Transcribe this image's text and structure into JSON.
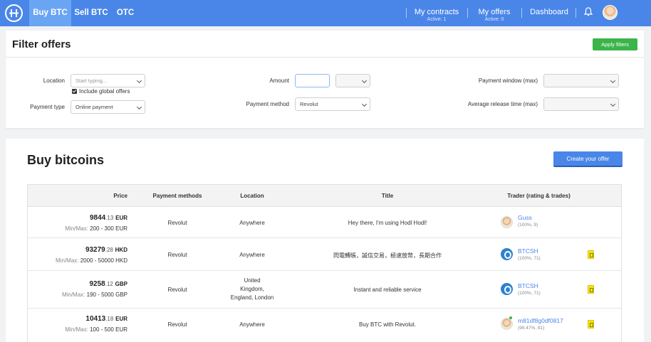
{
  "nav": {
    "tabs": [
      {
        "label": "Buy BTC",
        "active": true
      },
      {
        "label": "Sell BTC",
        "active": false
      },
      {
        "label": "OTC",
        "active": false
      }
    ],
    "links": [
      {
        "label": "My contracts",
        "sub": "Active: 1"
      },
      {
        "label": "My offers",
        "sub": "Active: 0"
      },
      {
        "label": "Dashboard",
        "sub": ""
      }
    ],
    "accent": "#4a86e8"
  },
  "filter": {
    "title": "Filter offers",
    "apply_label": "Apply filters",
    "location_label": "Location",
    "location_placeholder": "Start typing...",
    "include_global_label": "Include global offers",
    "include_global_checked": true,
    "payment_type_label": "Payment type",
    "payment_type_value": "Online payment",
    "amount_label": "Amount",
    "amount_value": "",
    "payment_method_label": "Payment method",
    "payment_method_value": "Revolut",
    "payment_window_label": "Payment window (max)",
    "release_time_label": "Average release time (max)"
  },
  "buy": {
    "title": "Buy bitcoins",
    "create_label": "Create your offer",
    "headers": {
      "price": "Price",
      "methods": "Payment methods",
      "location": "Location",
      "title": "Title",
      "trader": "Trader (rating & trades)"
    },
    "minmax_label": "Min/Max:",
    "rows": [
      {
        "price_int": "9844",
        "price_dec": ".13",
        "currency": "EUR",
        "minmax": "200 - 300 EUR",
        "method": "Revolut",
        "location": "Anywhere",
        "title": "Hey there, I'm using Hodl Hodl!",
        "trader": "Guss",
        "meta": "(100%, 9)",
        "avatar": "user",
        "verified": false
      },
      {
        "price_int": "93279",
        "price_dec": ".28",
        "currency": "HKD",
        "minmax": "2000 - 50000 HKD",
        "method": "Revolut",
        "location": "Anywhere",
        "title": "閃電轉賬，誠信交易，極速放幣，長期合作",
        "trader": "BTCSH",
        "meta": "(100%, 71)",
        "avatar": "btcsh",
        "verified": true
      },
      {
        "price_int": "9258",
        "price_dec": ".12",
        "currency": "GBP",
        "minmax": "190 - 5000 GBP",
        "method": "Revolut",
        "location": "United Kingdom, England, London",
        "location_lines": [
          "United",
          "Kingdom,",
          "England, London"
        ],
        "title": "Instant and reliable service",
        "trader": "BTCSH",
        "meta": "(100%, 71)",
        "avatar": "btcsh",
        "verified": true
      },
      {
        "price_int": "10413",
        "price_dec": ".18",
        "currency": "EUR",
        "minmax": "100 - 500 EUR",
        "method": "Revolut",
        "location": "Anywhere",
        "title": "Buy BTC with Revolut.",
        "trader": "m81df8g0df0817",
        "meta": "(99.47%, 81)",
        "avatar": "user",
        "verified": true
      }
    ]
  }
}
